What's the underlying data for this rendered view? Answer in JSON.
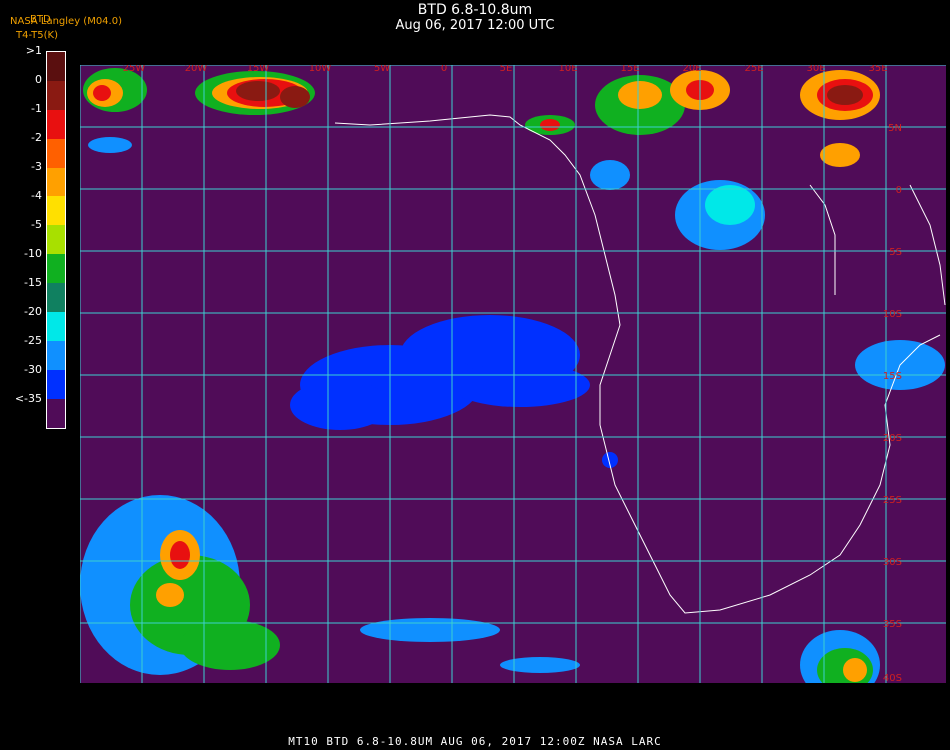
{
  "title": "BTD 6.8-10.8um",
  "subtitle": "Aug 06, 2017 12:00 UTC",
  "credit": "NASA Langley (M04.0)",
  "variable_label": "BTD",
  "units_label": "T4-T5(K)",
  "footer": "MT10  BTD 6.8-10.8UM   AUG 06, 2017 12:00Z   NASA LARC",
  "colorbar": {
    "labels": [
      ">1",
      "0",
      "-1",
      "-2",
      "-3",
      "-4",
      "-5",
      "-10",
      "-15",
      "-20",
      "-25",
      "-30",
      "<-35"
    ],
    "colors": [
      "#5a0f0f",
      "#8a1a12",
      "#e81010",
      "#ff6000",
      "#ffa000",
      "#ffe000",
      "#a8e000",
      "#10b020",
      "#108060",
      "#00e8e8",
      "#1090ff",
      "#0030ff",
      "#500c58"
    ]
  },
  "map": {
    "background_color": "#500c58",
    "grid_color": "#3dd0d0",
    "coast_color": "#ffffff",
    "label_color": "#d02020",
    "lon_labels": [
      "25W",
      "20W",
      "15W",
      "10W",
      "5W",
      "0",
      "5E",
      "10E",
      "15E",
      "20E",
      "25E",
      "30E",
      "35E"
    ],
    "lat_labels": [
      "5N",
      "0",
      "5S",
      "10S",
      "15S",
      "20S",
      "25S",
      "30S",
      "35S",
      "40S"
    ]
  }
}
